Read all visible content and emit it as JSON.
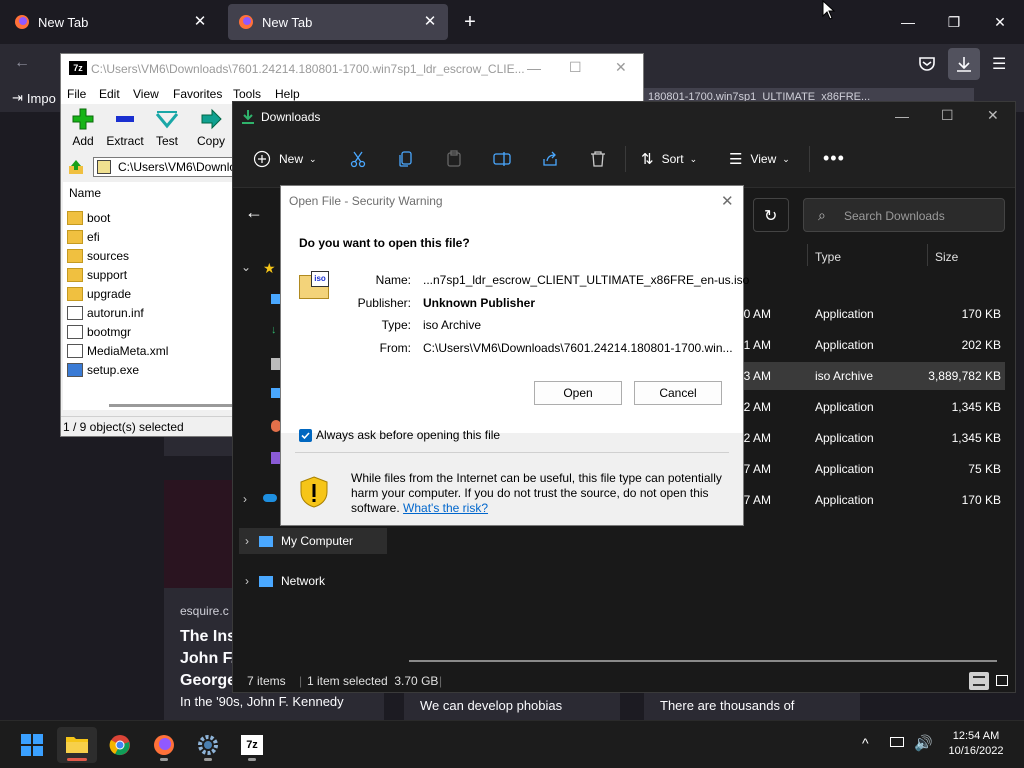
{
  "firefox": {
    "tabs": [
      {
        "label": "New Tab"
      },
      {
        "label": "New Tab"
      }
    ],
    "bookmark_import": "Impo",
    "cards": [
      {
        "source": "esquire.c",
        "title_lines": [
          "The Ins",
          "John F.",
          "George"
        ],
        "snippet": "In the '90s, John F. Kennedy"
      },
      {
        "snippet": "We can develop phobias"
      },
      {
        "snippet": "There are thousands of"
      }
    ],
    "downloads_hint": "180801-1700.win7sp1_ULTIMATE_x86FRE..."
  },
  "sevenzip": {
    "title": "C:\\Users\\VM6\\Downloads\\7601.24214.180801-1700.win7sp1_ldr_escrow_CLIE...",
    "menu": [
      "File",
      "Edit",
      "View",
      "Favorites",
      "Tools",
      "Help"
    ],
    "toolbar": [
      "Add",
      "Extract",
      "Test",
      "Copy"
    ],
    "path": "C:\\Users\\VM6\\Downlo",
    "column_name": "Name",
    "items": [
      {
        "name": "boot",
        "kind": "folder"
      },
      {
        "name": "efi",
        "kind": "folder"
      },
      {
        "name": "sources",
        "kind": "folder"
      },
      {
        "name": "support",
        "kind": "folder"
      },
      {
        "name": "upgrade",
        "kind": "folder"
      },
      {
        "name": "autorun.inf",
        "kind": "file"
      },
      {
        "name": "bootmgr",
        "kind": "file"
      },
      {
        "name": "MediaMeta.xml",
        "kind": "file"
      },
      {
        "name": "setup.exe",
        "kind": "exe"
      }
    ],
    "status": "1 / 9 object(s) selected"
  },
  "explorer": {
    "title": "Downloads",
    "commands": {
      "new": "New",
      "sort": "Sort",
      "view": "View"
    },
    "search_placeholder": "Search Downloads",
    "columns": {
      "type": "Type",
      "size": "Size"
    },
    "rows": [
      {
        "time": "30 AM",
        "type": "Application",
        "size": "170 KB"
      },
      {
        "time": "21 AM",
        "type": "Application",
        "size": "202 KB"
      },
      {
        "time": "53 AM",
        "type": "iso Archive",
        "size": "3,889,782 KB"
      },
      {
        "time": "42 AM",
        "type": "Application",
        "size": "1,345 KB"
      },
      {
        "time": "42 AM",
        "type": "Application",
        "size": "1,345 KB"
      },
      {
        "time": "37 AM",
        "type": "Application",
        "size": "75 KB"
      },
      {
        "time": "37 AM",
        "type": "Application",
        "size": "170 KB"
      }
    ],
    "nav": {
      "my_computer": "My Computer",
      "network": "Network"
    },
    "status": {
      "items": "7 items",
      "selected": "1 item selected  3.70 GB"
    }
  },
  "dialog": {
    "title": "Open File - Security Warning",
    "question": "Do you want to open this file?",
    "labels": {
      "name": "Name:",
      "publisher": "Publisher:",
      "type": "Type:",
      "from": "From:"
    },
    "values": {
      "name": "...n7sp1_ldr_escrow_CLIENT_ULTIMATE_x86FRE_en-us.iso",
      "publisher": "Unknown Publisher",
      "type": "iso Archive",
      "from": "C:\\Users\\VM6\\Downloads\\7601.24214.180801-1700.win..."
    },
    "open_button": "Open",
    "cancel_button": "Cancel",
    "checkbox_label": "Always ask before opening this file",
    "checkbox_checked": true,
    "warning_text": "While files from the Internet can be useful, this file type can potentially harm your computer. If you do not trust the source, do not open this software.",
    "risk_link": "What's the risk?"
  },
  "taskbar": {
    "time": "12:54 AM",
    "date": "10/16/2022"
  }
}
